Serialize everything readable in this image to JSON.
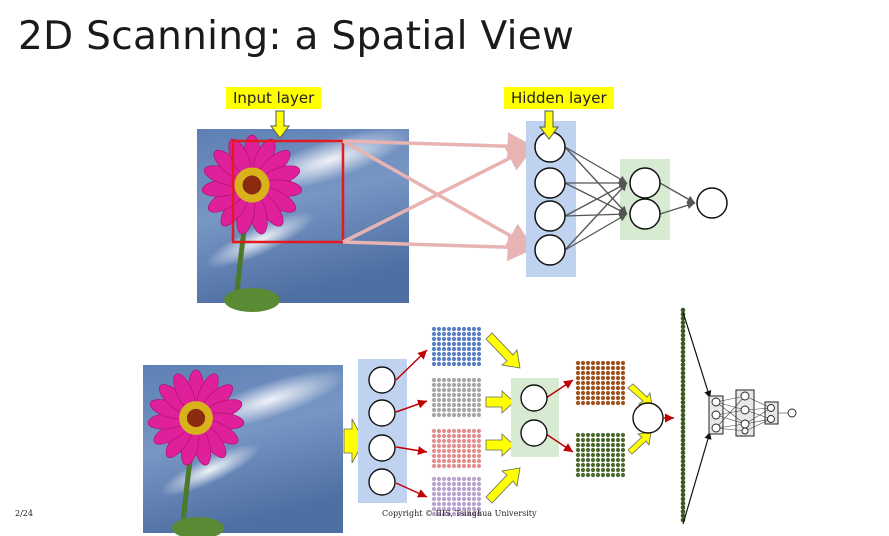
{
  "slide": {
    "title": "2D Scanning: a Spatial View",
    "labels": {
      "input_layer": "Input layer",
      "hidden_layer": "Hidden layer"
    },
    "footer": {
      "page": "2/24",
      "copyright": "Copyright © IIIS, Tsinghua University"
    }
  },
  "colors": {
    "highlight_yellow": "#ffff00",
    "scan_box_red": "#e11b22",
    "hidden_panel_blue": "#bfd3f0",
    "hidden_panel_green": "#d7ebd2",
    "grid_blue": "#5a7fc4",
    "grid_gray": "#a6a6a6",
    "grid_pink": "#e38f8f",
    "grid_lavender": "#b9a3cf",
    "grid_brown": "#a0521d",
    "grid_olive": "#4b6a2e",
    "flatten_column": "#3d5a1e"
  }
}
